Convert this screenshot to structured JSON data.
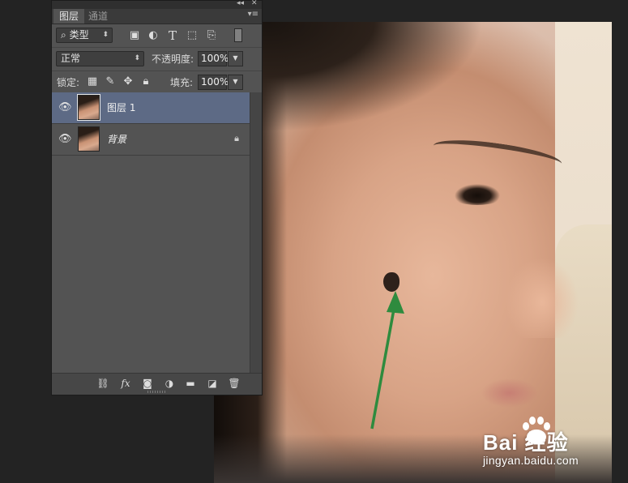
{
  "panel": {
    "tabs": [
      {
        "label": "图层",
        "active": true
      },
      {
        "label": "通道",
        "active": false
      }
    ],
    "collapse_icon": "double-chevron-left-icon",
    "close_icon": "close-icon",
    "menu_icon": "panel-menu-icon",
    "filter": {
      "kind_label": "类型",
      "icons": [
        "filter-pixel-icon",
        "filter-adjustment-icon",
        "filter-type-icon",
        "filter-shape-icon",
        "filter-smartobject-icon",
        "filter-toggle-icon"
      ],
      "type_glyph": "T"
    },
    "blend": {
      "mode": "正常",
      "opacity_label": "不透明度:",
      "opacity_value": "100%"
    },
    "lock": {
      "label": "锁定:",
      "icons": [
        "lock-transparent-icon",
        "lock-brush-icon",
        "lock-move-icon",
        "lock-all-icon"
      ],
      "fill_label": "填充:",
      "fill_value": "100%"
    },
    "layers": [
      {
        "name": "图层 1",
        "selected": true,
        "visible": true,
        "locked": false,
        "italic": false
      },
      {
        "name": "背景",
        "selected": false,
        "visible": true,
        "locked": true,
        "italic": true
      }
    ],
    "bottom_icons": [
      "link-icon",
      "fx-icon",
      "mask-icon",
      "adjustment-icon",
      "folder-icon",
      "new-layer-icon",
      "trash-icon"
    ],
    "fx_label": "fx"
  },
  "watermark": {
    "logo_text": "Bai  经验",
    "url": "jingyan.baidu.com"
  },
  "colors": {
    "panel_bg": "#535353",
    "selected_layer": "#5d6a85",
    "arrow": "#2e8b3e"
  }
}
